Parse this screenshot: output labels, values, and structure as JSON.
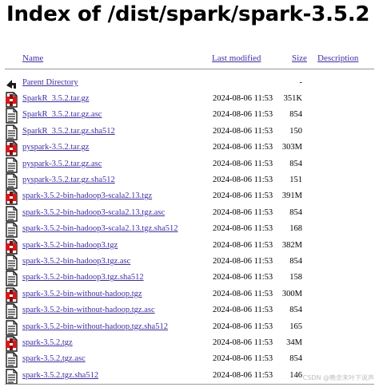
{
  "page": {
    "title": "Index of /dist/spark/spark-3.5.2"
  },
  "columns": {
    "name": "Name",
    "last_modified": "Last modified",
    "size": "Size",
    "description": "Description"
  },
  "parent": {
    "label": "Parent Directory",
    "size": "-"
  },
  "files": [
    {
      "name": "SparkR_3.5.2.tar.gz",
      "modified": "2024-08-06 11:53",
      "size": "351K",
      "icon": "compressed-file-icon"
    },
    {
      "name": "SparkR_3.5.2.tar.gz.asc",
      "modified": "2024-08-06 11:53",
      "size": "854",
      "icon": "text-file-icon"
    },
    {
      "name": "SparkR_3.5.2.tar.gz.sha512",
      "modified": "2024-08-06 11:53",
      "size": "150",
      "icon": "text-file-icon"
    },
    {
      "name": "pyspark-3.5.2.tar.gz",
      "modified": "2024-08-06 11:53",
      "size": "303M",
      "icon": "compressed-file-icon"
    },
    {
      "name": "pyspark-3.5.2.tar.gz.asc",
      "modified": "2024-08-06 11:53",
      "size": "854",
      "icon": "text-file-icon"
    },
    {
      "name": "pyspark-3.5.2.tar.gz.sha512",
      "modified": "2024-08-06 11:53",
      "size": "151",
      "icon": "text-file-icon"
    },
    {
      "name": "spark-3.5.2-bin-hadoop3-scala2.13.tgz",
      "modified": "2024-08-06 11:53",
      "size": "391M",
      "icon": "compressed-file-icon"
    },
    {
      "name": "spark-3.5.2-bin-hadoop3-scala2.13.tgz.asc",
      "modified": "2024-08-06 11:53",
      "size": "854",
      "icon": "text-file-icon"
    },
    {
      "name": "spark-3.5.2-bin-hadoop3-scala2.13.tgz.sha512",
      "modified": "2024-08-06 11:53",
      "size": "168",
      "icon": "text-file-icon"
    },
    {
      "name": "spark-3.5.2-bin-hadoop3.tgz",
      "modified": "2024-08-06 11:53",
      "size": "382M",
      "icon": "compressed-file-icon"
    },
    {
      "name": "spark-3.5.2-bin-hadoop3.tgz.asc",
      "modified": "2024-08-06 11:53",
      "size": "854",
      "icon": "text-file-icon"
    },
    {
      "name": "spark-3.5.2-bin-hadoop3.tgz.sha512",
      "modified": "2024-08-06 11:53",
      "size": "158",
      "icon": "text-file-icon"
    },
    {
      "name": "spark-3.5.2-bin-without-hadoop.tgz",
      "modified": "2024-08-06 11:53",
      "size": "300M",
      "icon": "compressed-file-icon"
    },
    {
      "name": "spark-3.5.2-bin-without-hadoop.tgz.asc",
      "modified": "2024-08-06 11:53",
      "size": "854",
      "icon": "text-file-icon"
    },
    {
      "name": "spark-3.5.2-bin-without-hadoop.tgz.sha512",
      "modified": "2024-08-06 11:53",
      "size": "165",
      "icon": "text-file-icon"
    },
    {
      "name": "spark-3.5.2.tgz",
      "modified": "2024-08-06 11:53",
      "size": "34M",
      "icon": "compressed-file-icon"
    },
    {
      "name": "spark-3.5.2.tgz.asc",
      "modified": "2024-08-06 11:53",
      "size": "854",
      "icon": "text-file-icon"
    },
    {
      "name": "spark-3.5.2.tgz.sha512",
      "modified": "2024-08-06 11:53",
      "size": "146",
      "icon": "text-file-icon"
    }
  ],
  "watermark": "CSDN @晚余末叶下说声",
  "colors": {
    "link": "#3c2fa0",
    "archive_icon": "#d61a1a",
    "separator": "#9a9a9a"
  }
}
